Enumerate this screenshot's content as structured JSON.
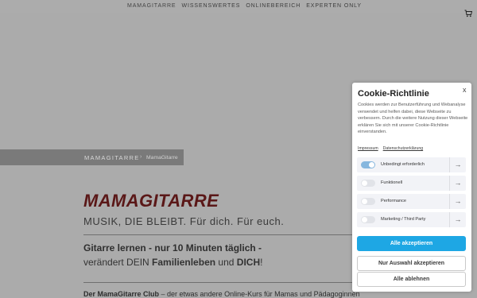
{
  "nav": {
    "items": [
      {
        "label": "MAMAGITARRE"
      },
      {
        "label": "WISSENSWERTES"
      },
      {
        "label": "ONLINEBEREICH"
      },
      {
        "label": "EXPERTEN ONLY"
      }
    ],
    "cart_icon": "cart-icon"
  },
  "breadcrumb": {
    "home": "MAMAGITARRE",
    "separator": "›",
    "current": "MamaGitarre"
  },
  "main": {
    "title": "MAMAGITARRE",
    "subtitle": "MUSIK, DIE BLEIBT. Für dich. Für euch.",
    "lead1": "Gitarre lernen - nur 10 Minuten täglich -",
    "lead2_pre": "verändert DEIN ",
    "lead2_bold1": "Familienleben",
    "lead2_mid": " und ",
    "lead2_bold2": "DICH",
    "lead2_post": "!",
    "intro_bold": "Der MamaGitarre Club",
    "intro_rest": " – der etwas andere Online-Kurs für Mamas und Pädagoginnen"
  },
  "cookie": {
    "title": "Cookie-Richtlinie",
    "close": "x",
    "text": "Cookies werden zur Benutzerführung und Webanalyse verwendet und helfen dabei, diese Webseite zu verbessern. Durch die weitere Nutzung dieser Webseite erklären Sie sich mit unserer Cookie-Richtlinie einverstanden.",
    "link_impressum": "Impressum",
    "link_datenschutz": "Datenschutzerklärung",
    "categories": [
      {
        "label": "Unbedingt erforderlich",
        "enabled": true
      },
      {
        "label": "Funktionell",
        "enabled": false
      },
      {
        "label": "Performance",
        "enabled": false
      },
      {
        "label": "Marketing / Third Party",
        "enabled": false
      }
    ],
    "arrow": "→",
    "accept_all": "Alle akzeptieren",
    "accept_selection": "Nur Auswahl akzeptieren",
    "reject_all": "Alle ablehnen",
    "accent_color": "#1ea7e4"
  }
}
